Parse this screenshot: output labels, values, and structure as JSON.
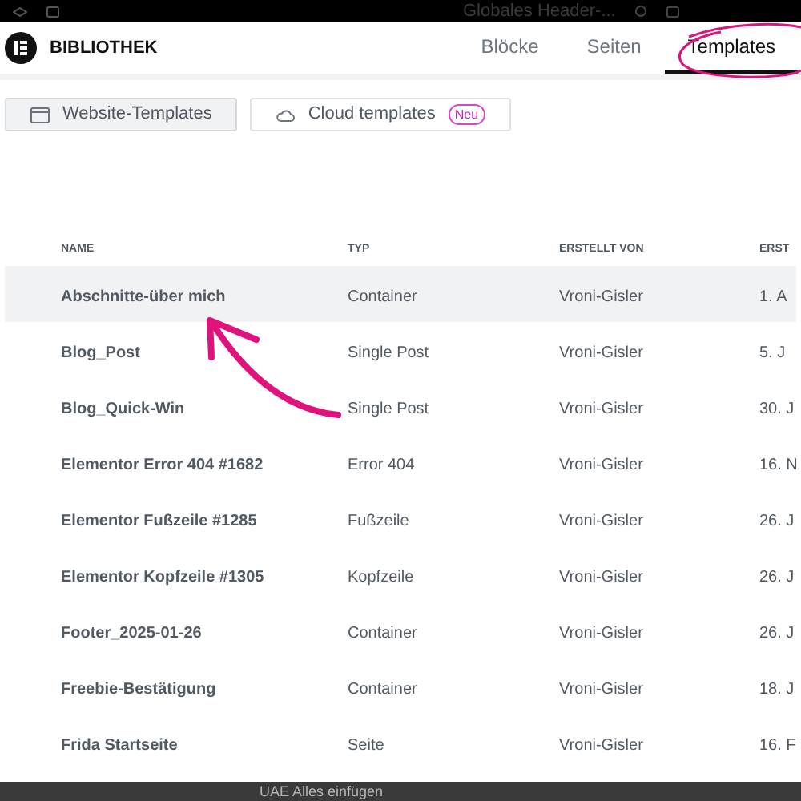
{
  "top_bar": {
    "title": "Globales Header-..."
  },
  "header": {
    "title": "BIBLIOTHEK",
    "tabs": [
      {
        "label": "Blöcke",
        "selected": false
      },
      {
        "label": "Seiten",
        "selected": false
      },
      {
        "label": "Templates",
        "selected": true
      }
    ]
  },
  "filters": [
    {
      "label": "Website-Templates",
      "kind": "website",
      "selected": true
    },
    {
      "label": "Cloud templates",
      "kind": "cloud",
      "selected": false,
      "badge": "Neu"
    }
  ],
  "table": {
    "columns": [
      "NAME",
      "TYP",
      "ERSTELLT VON",
      "ERST"
    ],
    "rows": [
      {
        "cells": [
          "Abschnitte-über mich",
          "Container",
          "Vroni-Gisler",
          "1. A"
        ],
        "selected": true
      },
      {
        "cells": [
          "Blog_Post",
          "Single Post",
          "Vroni-Gisler",
          "5. J"
        ],
        "selected": false
      },
      {
        "cells": [
          "Blog_Quick-Win",
          "Single Post",
          "Vroni-Gisler",
          "30. J"
        ],
        "selected": false
      },
      {
        "cells": [
          "Elementor Error 404 #1682",
          "Error 404",
          "Vroni-Gisler",
          "16. N"
        ],
        "selected": false
      },
      {
        "cells": [
          "Elementor Fußzeile #1285",
          "Fußzeile",
          "Vroni-Gisler",
          "26. J"
        ],
        "selected": false
      },
      {
        "cells": [
          "Elementor Kopfzeile #1305",
          "Kopfzeile",
          "Vroni-Gisler",
          "26. J"
        ],
        "selected": false
      },
      {
        "cells": [
          "Footer_2025-01-26",
          "Container",
          "Vroni-Gisler",
          "26. J"
        ],
        "selected": false
      },
      {
        "cells": [
          "Freebie-Bestätigung",
          "Container",
          "Vroni-Gisler",
          "18. J"
        ],
        "selected": false
      },
      {
        "cells": [
          "Frida Startseite",
          "Seite",
          "Vroni-Gisler",
          "16. F"
        ],
        "selected": false
      }
    ]
  },
  "bottom_bar": {
    "text": "UAE Alles einfügen"
  }
}
